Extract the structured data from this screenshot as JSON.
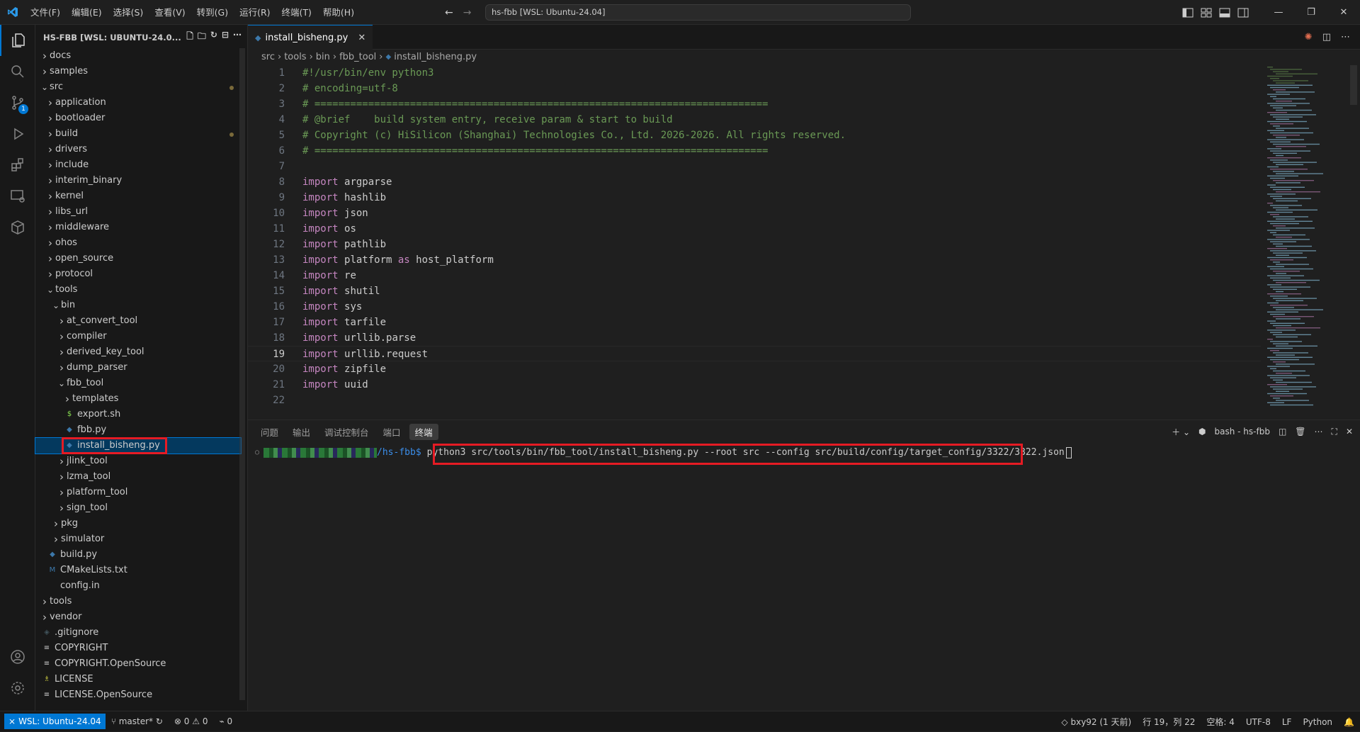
{
  "titlebar": {
    "menus": [
      "文件(F)",
      "编辑(E)",
      "选择(S)",
      "查看(V)",
      "转到(G)",
      "运行(R)",
      "终端(T)",
      "帮助(H)"
    ],
    "command_center": "hs-fbb [WSL: Ubuntu-24.04]"
  },
  "activity": {
    "scm_badge": "1"
  },
  "sidebar": {
    "title": "HS-FBB [WSL: UBUNTU-24.0...",
    "tree": [
      {
        "label": "docs",
        "depth": 0,
        "type": "folder",
        "open": false
      },
      {
        "label": "samples",
        "depth": 0,
        "type": "folder",
        "open": false
      },
      {
        "label": "src",
        "depth": 0,
        "type": "folder",
        "open": true,
        "modified": true
      },
      {
        "label": "application",
        "depth": 1,
        "type": "folder",
        "open": false
      },
      {
        "label": "bootloader",
        "depth": 1,
        "type": "folder",
        "open": false
      },
      {
        "label": "build",
        "depth": 1,
        "type": "folder",
        "open": false,
        "modified": true
      },
      {
        "label": "drivers",
        "depth": 1,
        "type": "folder",
        "open": false
      },
      {
        "label": "include",
        "depth": 1,
        "type": "folder",
        "open": false
      },
      {
        "label": "interim_binary",
        "depth": 1,
        "type": "folder",
        "open": false
      },
      {
        "label": "kernel",
        "depth": 1,
        "type": "folder",
        "open": false
      },
      {
        "label": "libs_url",
        "depth": 1,
        "type": "folder",
        "open": false
      },
      {
        "label": "middleware",
        "depth": 1,
        "type": "folder",
        "open": false
      },
      {
        "label": "ohos",
        "depth": 1,
        "type": "folder",
        "open": false
      },
      {
        "label": "open_source",
        "depth": 1,
        "type": "folder",
        "open": false
      },
      {
        "label": "protocol",
        "depth": 1,
        "type": "folder",
        "open": false
      },
      {
        "label": "tools",
        "depth": 1,
        "type": "folder",
        "open": true
      },
      {
        "label": "bin",
        "depth": 2,
        "type": "folder",
        "open": true
      },
      {
        "label": "at_convert_tool",
        "depth": 3,
        "type": "folder",
        "open": false
      },
      {
        "label": "compiler",
        "depth": 3,
        "type": "folder",
        "open": false
      },
      {
        "label": "derived_key_tool",
        "depth": 3,
        "type": "folder",
        "open": false
      },
      {
        "label": "dump_parser",
        "depth": 3,
        "type": "folder",
        "open": false
      },
      {
        "label": "fbb_tool",
        "depth": 3,
        "type": "folder",
        "open": true
      },
      {
        "label": "templates",
        "depth": 4,
        "type": "folder",
        "open": false
      },
      {
        "label": "export.sh",
        "depth": 4,
        "type": "sh"
      },
      {
        "label": "fbb.py",
        "depth": 4,
        "type": "py"
      },
      {
        "label": "install_bisheng.py",
        "depth": 4,
        "type": "py",
        "selected": true
      },
      {
        "label": "jlink_tool",
        "depth": 3,
        "type": "folder",
        "open": false
      },
      {
        "label": "lzma_tool",
        "depth": 3,
        "type": "folder",
        "open": false
      },
      {
        "label": "platform_tool",
        "depth": 3,
        "type": "folder",
        "open": false
      },
      {
        "label": "sign_tool",
        "depth": 3,
        "type": "folder",
        "open": false
      },
      {
        "label": "pkg",
        "depth": 2,
        "type": "folder",
        "open": false
      },
      {
        "label": "simulator",
        "depth": 2,
        "type": "folder",
        "open": false
      },
      {
        "label": "build.py",
        "depth": 1,
        "type": "py"
      },
      {
        "label": "CMakeLists.txt",
        "depth": 1,
        "type": "cmake"
      },
      {
        "label": "config.in",
        "depth": 1,
        "type": "txt"
      },
      {
        "label": "tools",
        "depth": 0,
        "type": "folder",
        "open": false
      },
      {
        "label": "vendor",
        "depth": 0,
        "type": "folder",
        "open": false
      },
      {
        "label": ".gitignore",
        "depth": 0,
        "type": "git"
      },
      {
        "label": "COPYRIGHT",
        "depth": 0,
        "type": "lines"
      },
      {
        "label": "COPYRIGHT.OpenSource",
        "depth": 0,
        "type": "lines"
      },
      {
        "label": "LICENSE",
        "depth": 0,
        "type": "license"
      },
      {
        "label": "LICENSE.OpenSource",
        "depth": 0,
        "type": "lines"
      }
    ]
  },
  "editor": {
    "tab_label": "install_bisheng.py",
    "breadcrumb": [
      "src",
      "tools",
      "bin",
      "fbb_tool",
      "install_bisheng.py"
    ],
    "current_line": 19,
    "lines": [
      {
        "n": "1",
        "t": "#!/usr/bin/env python3",
        "k": "cm"
      },
      {
        "n": "2",
        "t": "# encoding=utf-8",
        "k": "cm"
      },
      {
        "n": "3",
        "t": "# ============================================================================",
        "k": "cm"
      },
      {
        "n": "4",
        "t": "# @brief    build system entry, receive param & start to build",
        "k": "cm"
      },
      {
        "n": "5",
        "t": "# Copyright (c) HiSilicon (Shanghai) Technologies Co., Ltd. 2026-2026. All rights reserved.",
        "k": "cm"
      },
      {
        "n": "6",
        "t": "# ============================================================================",
        "k": "cm"
      },
      {
        "n": "7",
        "t": "",
        "k": ""
      },
      {
        "n": "8",
        "t": "argparse",
        "k": "imp"
      },
      {
        "n": "9",
        "t": "hashlib",
        "k": "imp"
      },
      {
        "n": "10",
        "t": "json",
        "k": "imp"
      },
      {
        "n": "11",
        "t": "os",
        "k": "imp"
      },
      {
        "n": "12",
        "t": "pathlib",
        "k": "imp"
      },
      {
        "n": "13",
        "t": "platform",
        "k": "impas",
        "alias": "host_platform"
      },
      {
        "n": "14",
        "t": "re",
        "k": "imp"
      },
      {
        "n": "15",
        "t": "shutil",
        "k": "imp"
      },
      {
        "n": "16",
        "t": "sys",
        "k": "imp"
      },
      {
        "n": "17",
        "t": "tarfile",
        "k": "imp"
      },
      {
        "n": "18",
        "t": "urllib.parse",
        "k": "imp"
      },
      {
        "n": "19",
        "t": "urllib.request",
        "k": "imp"
      },
      {
        "n": "20",
        "t": "zipfile",
        "k": "imp"
      },
      {
        "n": "21",
        "t": "uuid",
        "k": "imp"
      },
      {
        "n": "22",
        "t": "",
        "k": ""
      }
    ]
  },
  "panel": {
    "tabs": [
      "问题",
      "输出",
      "调试控制台",
      "端口",
      "终端"
    ],
    "active_tab": 4,
    "terminal_name": "bash - hs-fbb",
    "prompt_path": "/hs-fbb$",
    "command": "python3 src/tools/bin/fbb_tool/install_bisheng.py --root src --config src/build/config/target_config/3322/3322.json"
  },
  "statusbar": {
    "remote": "WSL: Ubuntu-24.04",
    "branch": "master*",
    "errors": "0",
    "warnings": "0",
    "ports": "0",
    "blame": "bxy92 (1 天前)",
    "position": "行 19，列 22",
    "spaces": "空格: 4",
    "encoding": "UTF-8",
    "eol": "LF",
    "language": "Python"
  }
}
